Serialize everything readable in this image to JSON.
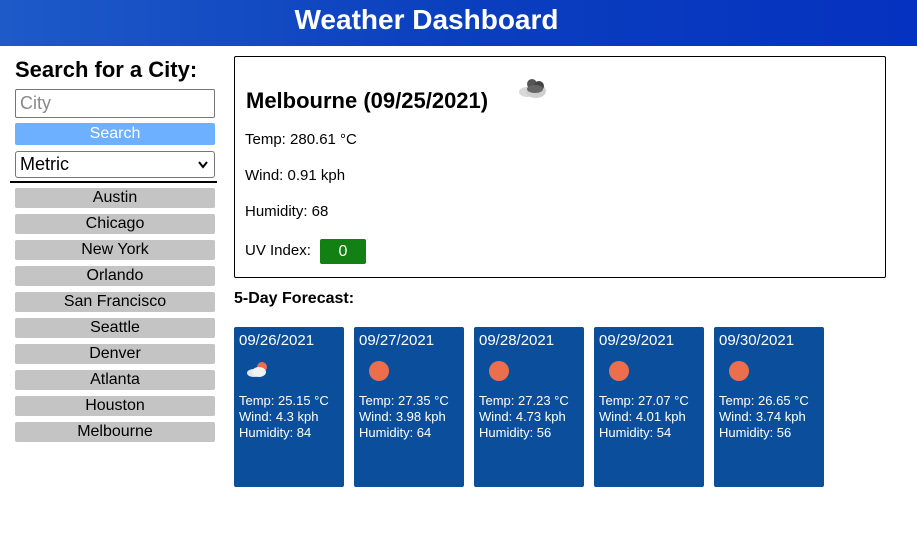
{
  "header": {
    "title": "Weather Dashboard"
  },
  "sidebar": {
    "search_title": "Search for a City:",
    "city_placeholder": "City",
    "city_value": "",
    "search_label": "Search",
    "unit_selected": "Metric",
    "history": [
      "Austin",
      "Chicago",
      "New York",
      "Orlando",
      "San Francisco",
      "Seattle",
      "Denver",
      "Atlanta",
      "Houston",
      "Melbourne"
    ]
  },
  "current": {
    "title": "Melbourne (09/25/2021)",
    "icon": "cloud-icon",
    "temp": "Temp: 280.61 °C",
    "wind": "Wind: 0.91 kph",
    "humidity": "Humidity: 68",
    "uv_label": "UV Index:",
    "uv_value": "0",
    "uv_color": "#128012"
  },
  "forecast": {
    "title": "5-Day Forecast:",
    "days": [
      {
        "date": "09/26/2021",
        "icon": "partly-cloudy-icon",
        "temp": "Temp: 25.15 °C",
        "wind": "Wind: 4.3 kph",
        "humidity": "Humidity: 84"
      },
      {
        "date": "09/27/2021",
        "icon": "sun-icon",
        "temp": "Temp: 27.35 °C",
        "wind": "Wind: 3.98 kph",
        "humidity": "Humidity: 64"
      },
      {
        "date": "09/28/2021",
        "icon": "sun-icon",
        "temp": "Temp: 27.23 °C",
        "wind": "Wind: 4.73 kph",
        "humidity": "Humidity: 56"
      },
      {
        "date": "09/29/2021",
        "icon": "sun-icon",
        "temp": "Temp: 27.07 °C",
        "wind": "Wind: 4.01 kph",
        "humidity": "Humidity: 54"
      },
      {
        "date": "09/30/2021",
        "icon": "sun-icon",
        "temp": "Temp: 26.65 °C",
        "wind": "Wind: 3.74 kph",
        "humidity": "Humidity: 56"
      }
    ]
  },
  "colors": {
    "header": "#0a3fbe",
    "search_button": "#6db0ff",
    "card": "#0b4e9c",
    "history_button": "#c4c4c4",
    "sun": "#ec6e4c"
  }
}
